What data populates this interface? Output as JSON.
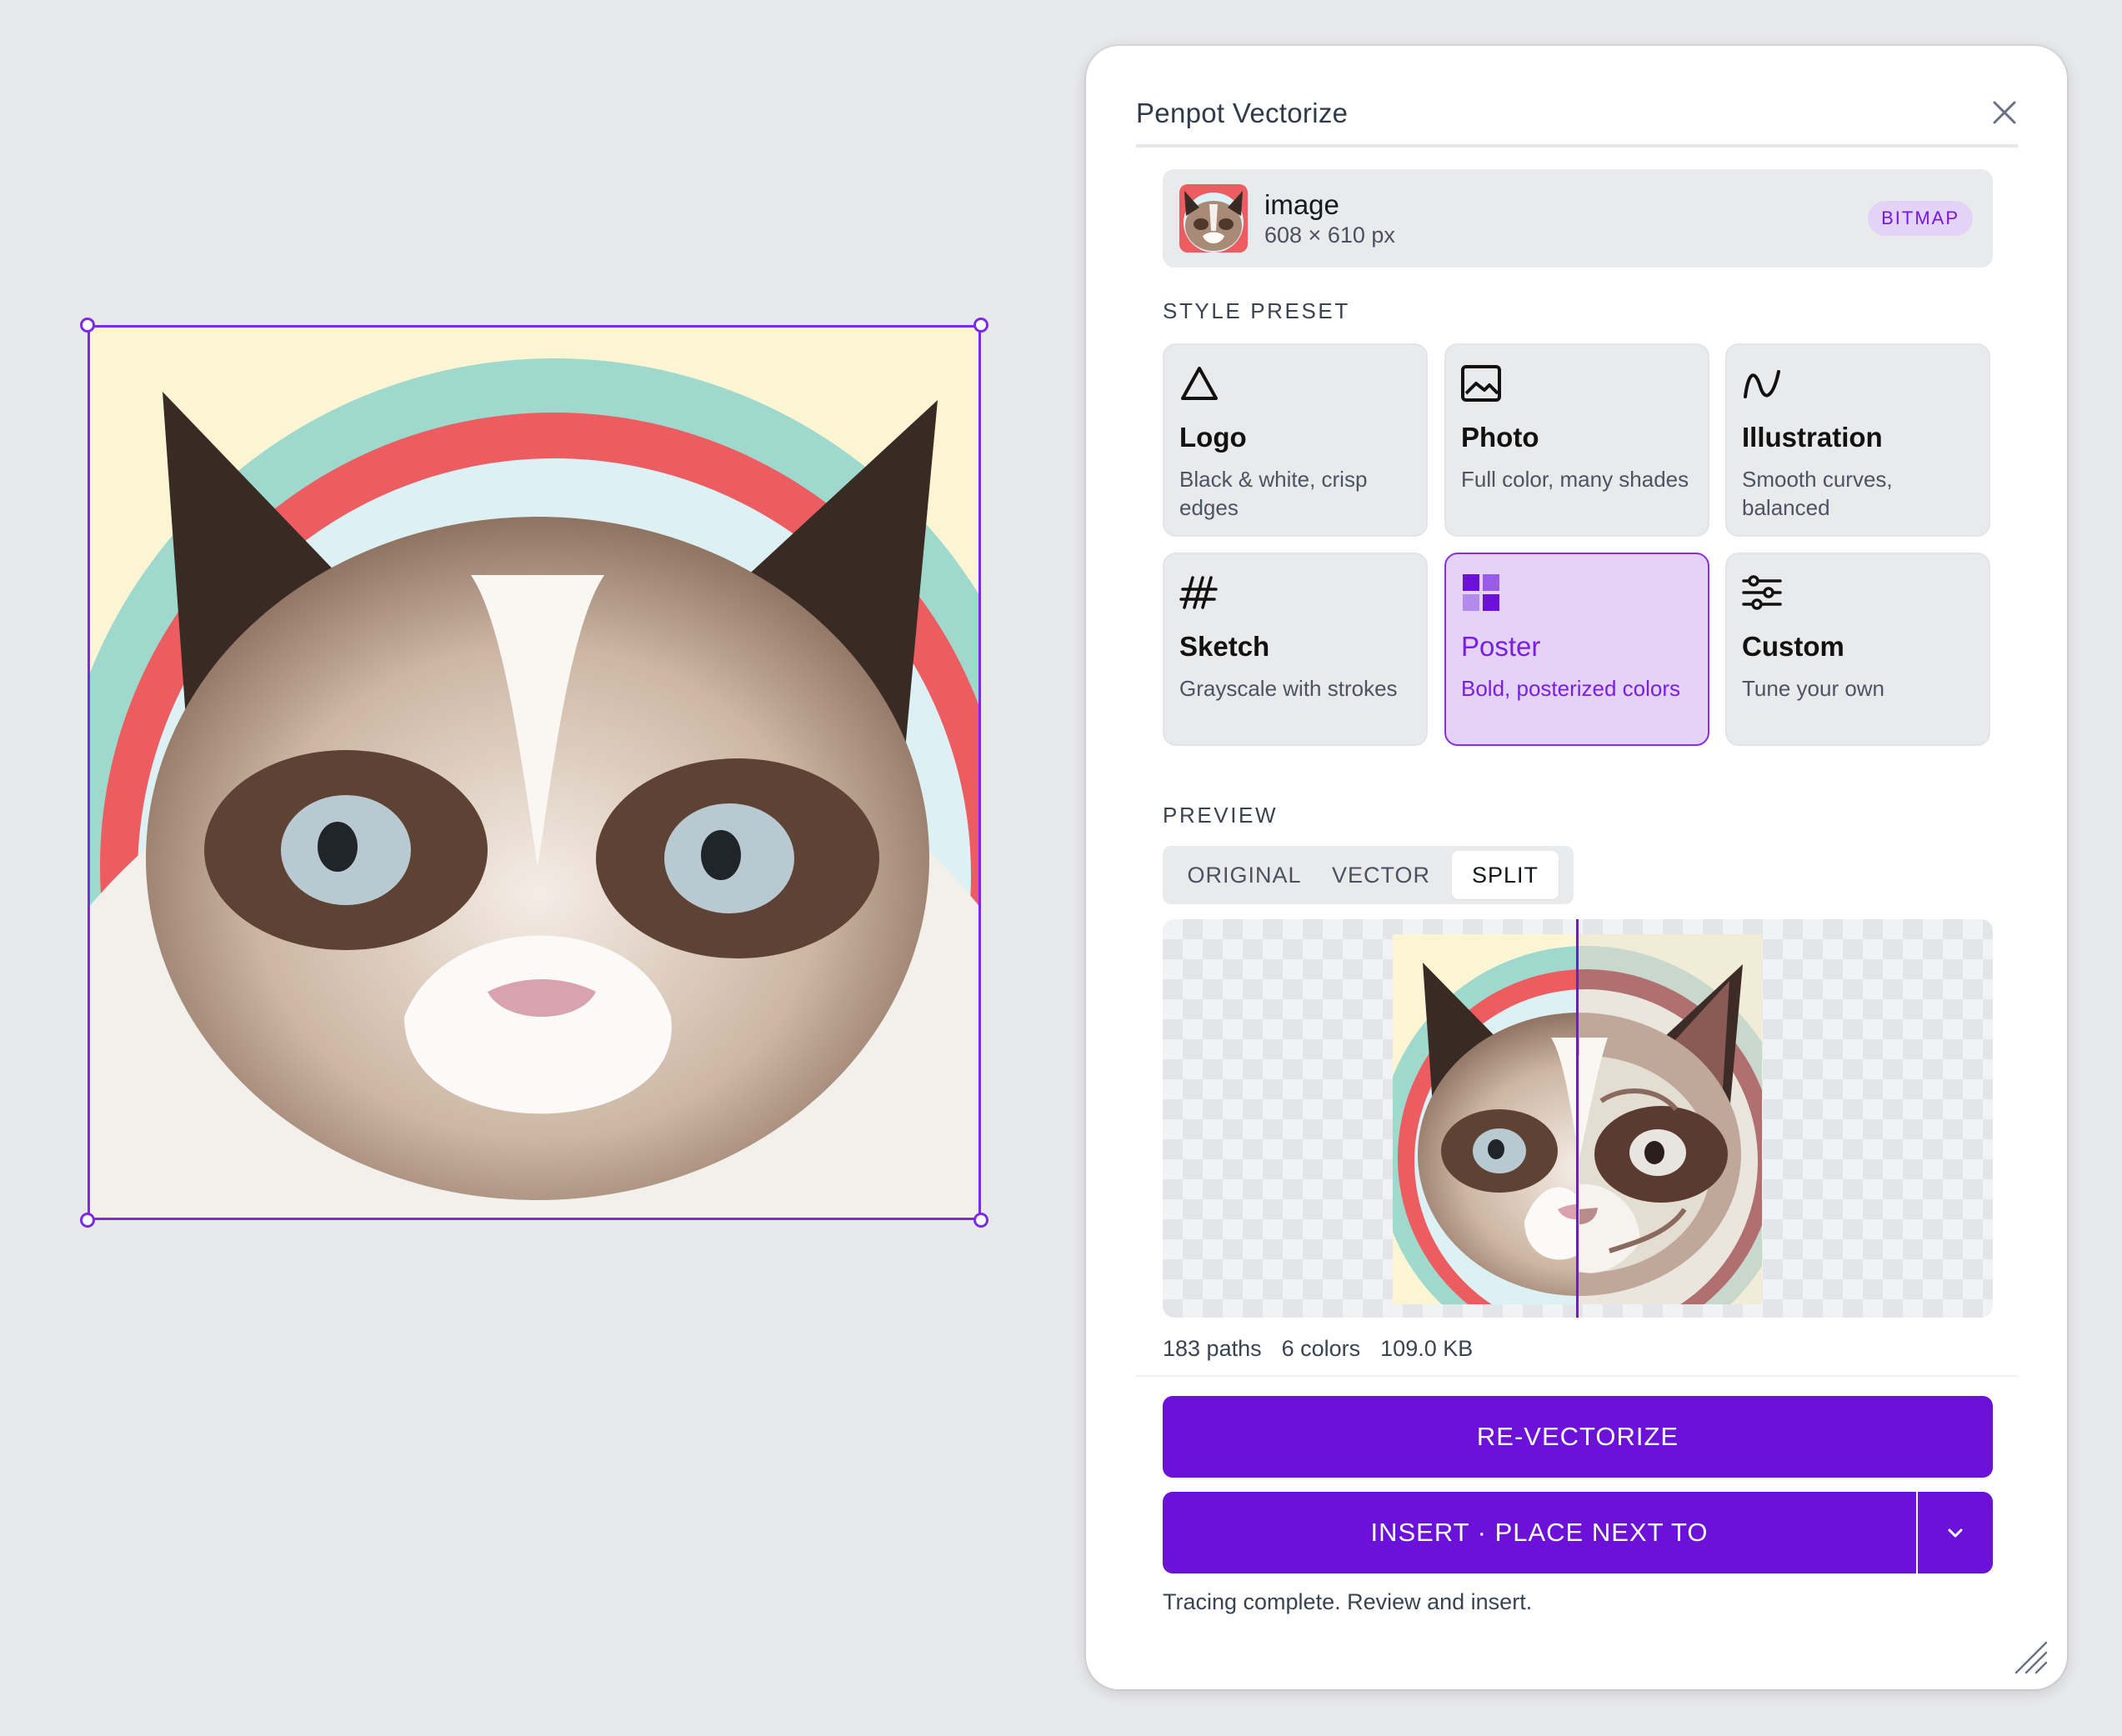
{
  "panel": {
    "title": "Penpot Vectorize",
    "close_icon": "close-icon"
  },
  "source": {
    "name": "image",
    "dimensions": "608 × 610 px",
    "badge": "BITMAP"
  },
  "style_preset": {
    "label": "STYLE PRESET",
    "selected": "Poster",
    "items": [
      {
        "name": "Logo",
        "description": "Black & white, crisp edges",
        "icon": "triangle-icon"
      },
      {
        "name": "Photo",
        "description": "Full color, many shades",
        "icon": "image-icon"
      },
      {
        "name": "Illustration",
        "description": "Smooth curves, balanced",
        "icon": "curve-icon"
      },
      {
        "name": "Sketch",
        "description": "Grayscale with strokes",
        "icon": "hatch-icon"
      },
      {
        "name": "Poster",
        "description": "Bold, posterized colors",
        "icon": "grid-squares-icon"
      },
      {
        "name": "Custom",
        "description": "Tune your own",
        "icon": "sliders-icon"
      }
    ]
  },
  "preview": {
    "label": "PREVIEW",
    "modes": [
      "ORIGINAL",
      "VECTOR",
      "SPLIT"
    ],
    "active_mode": "SPLIT"
  },
  "stats": {
    "paths": "183 paths",
    "colors": "6 colors",
    "size": "109.0 KB"
  },
  "actions": {
    "revectorize": "RE-VECTORIZE",
    "insert": "INSERT · PLACE NEXT TO",
    "insert_menu_icon": "chevron-down-icon"
  },
  "status": "Tracing complete. Review and insert.",
  "colors": {
    "accent": "#6c11d8",
    "selection": "#7b2be3",
    "active_preset_bg": "#e4d3f6"
  }
}
